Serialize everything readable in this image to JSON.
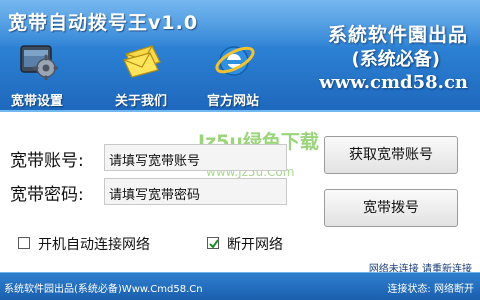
{
  "header": {
    "title": "宽带自动拨号王v1.0",
    "brand_line1": "系統软件園出品",
    "brand_line2": "(系统必备)",
    "brand_line3": "www.cmd58.cn",
    "nav": [
      {
        "label": "宽带设置",
        "icon": "settings-gear-icon"
      },
      {
        "label": "关于我们",
        "icon": "envelope-icon"
      },
      {
        "label": "官方网站",
        "icon": "ie-browser-icon"
      }
    ]
  },
  "form": {
    "account_label": "宽带账号:",
    "account_value": "请填写宽带账号",
    "password_label": "宽带密码:",
    "password_value": "请填写宽带密码",
    "get_account_button": "获取宽带账号",
    "dial_button": "宽带拨号"
  },
  "options": {
    "auto_connect_label": "开机自动连接网络",
    "auto_connect_checked": false,
    "disconnect_label": "断开网络",
    "disconnect_checked": true
  },
  "watermark": {
    "text": "Jz5u绿色下载",
    "url": "www.Jz5u.Com"
  },
  "network_status": "网络未连接 请重新连接",
  "statusbar": {
    "left": "系统软件园出品(系统必备)Www.Cmd58.Cn",
    "right": "连接状态: 网络断开"
  },
  "colors": {
    "header_blue": "#2c80d3",
    "status_blue": "#1a5fae",
    "watermark_green": "#79c74f",
    "check_green": "#1e8f2a"
  }
}
